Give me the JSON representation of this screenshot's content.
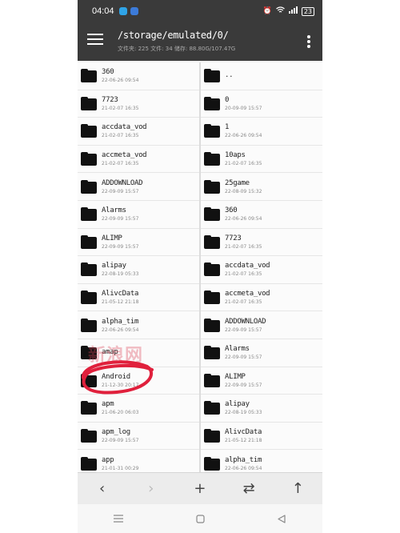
{
  "status_bar": {
    "time": "04:04",
    "battery": "23"
  },
  "header": {
    "path": "/storage/emulated/0/",
    "stats": "文件夹: 225  文件: 34  储存: 88.80G/107.47G"
  },
  "left_pane": [
    {
      "name": "360",
      "date": "22-06-26 09:54"
    },
    {
      "name": "7723",
      "date": "21-02-07 16:35"
    },
    {
      "name": "accdata_vod",
      "date": "21-02-07 16:35"
    },
    {
      "name": "accmeta_vod",
      "date": "21-02-07 16:35"
    },
    {
      "name": "ADDOWNLOAD",
      "date": "22-09-09 15:57"
    },
    {
      "name": "Alarms",
      "date": "22-09-09 15:57"
    },
    {
      "name": "ALIMP",
      "date": "22-09-09 15:57"
    },
    {
      "name": "alipay",
      "date": "22-08-19 05:33"
    },
    {
      "name": "AlivcData",
      "date": "21-05-12 21:18"
    },
    {
      "name": "alpha_tim",
      "date": "22-06-26 09:54"
    },
    {
      "name": "amap",
      "date": ""
    },
    {
      "name": "Android",
      "date": "21-12-30 20:17"
    },
    {
      "name": "apm",
      "date": "21-06-20 06:03"
    },
    {
      "name": "apm_log",
      "date": "22-09-09 15:57"
    },
    {
      "name": "app",
      "date": "21-01-31 00:29"
    }
  ],
  "right_pane": [
    {
      "name": "..",
      "date": ""
    },
    {
      "name": "0",
      "date": "20-09-09 15:57"
    },
    {
      "name": "1",
      "date": "22-06-26 09:54"
    },
    {
      "name": "10aps",
      "date": "21-02-07 16:35"
    },
    {
      "name": "25game",
      "date": "22-08-09 15:32"
    },
    {
      "name": "360",
      "date": "22-06-26 09:54"
    },
    {
      "name": "7723",
      "date": "21-02-07 16:35"
    },
    {
      "name": "accdata_vod",
      "date": "21-02-07 16:35"
    },
    {
      "name": "accmeta_vod",
      "date": "21-02-07 16:35"
    },
    {
      "name": "ADDOWNLOAD",
      "date": "22-09-09 15:57"
    },
    {
      "name": "Alarms",
      "date": "22-09-09 15:57"
    },
    {
      "name": "ALIMP",
      "date": "22-09-09 15:57"
    },
    {
      "name": "alipay",
      "date": "22-08-19 05:33"
    },
    {
      "name": "AlivcData",
      "date": "21-05-12 21:18"
    },
    {
      "name": "alpha_tim",
      "date": "22-06-26 09:54"
    }
  ],
  "toolbar": [
    {
      "name": "back-button",
      "icon": "chevron-left-icon",
      "glyph": "‹",
      "disabled": false
    },
    {
      "name": "forward-button",
      "icon": "chevron-right-icon",
      "glyph": "›",
      "disabled": true
    },
    {
      "name": "add-button",
      "icon": "plus-icon",
      "glyph": "+",
      "disabled": false
    },
    {
      "name": "swap-panes-button",
      "icon": "swap-arrows-icon",
      "glyph": "⇄",
      "disabled": false
    },
    {
      "name": "up-button",
      "icon": "arrow-up-icon",
      "glyph": "↑",
      "disabled": false
    }
  ],
  "watermark": "新浪网",
  "colors": {
    "appbar": "#3a3a3a",
    "annotation": "#e0203c"
  }
}
